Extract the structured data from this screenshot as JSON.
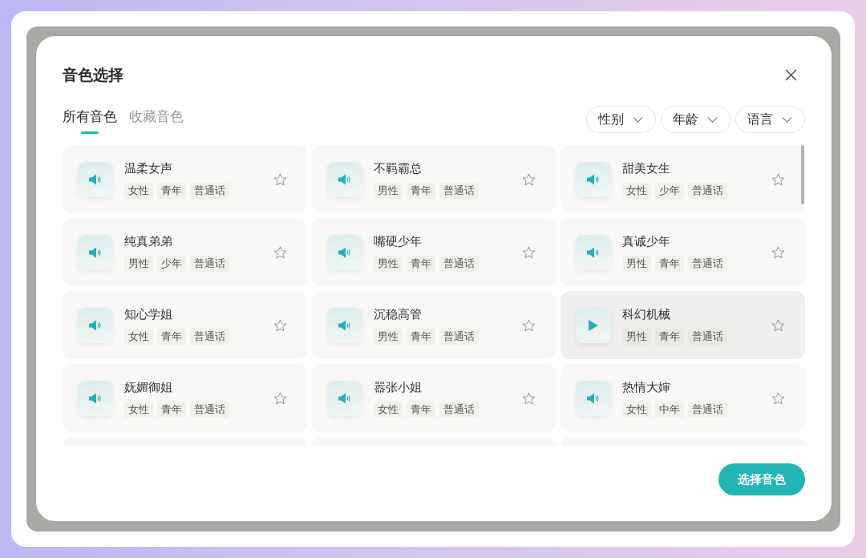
{
  "dialog": {
    "title": "音色选择"
  },
  "tabs": [
    {
      "label": "所有音色",
      "selected": true
    },
    {
      "label": "收藏音色",
      "selected": false
    }
  ],
  "filters": [
    {
      "label": "性别"
    },
    {
      "label": "年龄"
    },
    {
      "label": "语言"
    }
  ],
  "voices": [
    {
      "name": "温柔女声",
      "tags": [
        "女性",
        "青年",
        "普通话"
      ],
      "favorite": false,
      "hovered": false
    },
    {
      "name": "不羁霸总",
      "tags": [
        "男性",
        "青年",
        "普通话"
      ],
      "favorite": false,
      "hovered": false
    },
    {
      "name": "甜美女生",
      "tags": [
        "女性",
        "少年",
        "普通话"
      ],
      "favorite": false,
      "hovered": false
    },
    {
      "name": "纯真弟弟",
      "tags": [
        "男性",
        "少年",
        "普通话"
      ],
      "favorite": false,
      "hovered": false
    },
    {
      "name": "嘴硬少年",
      "tags": [
        "男性",
        "青年",
        "普通话"
      ],
      "favorite": false,
      "hovered": false
    },
    {
      "name": "真诚少年",
      "tags": [
        "男性",
        "青年",
        "普通话"
      ],
      "favorite": false,
      "hovered": false
    },
    {
      "name": "知心学姐",
      "tags": [
        "女性",
        "青年",
        "普通话"
      ],
      "favorite": false,
      "hovered": false
    },
    {
      "name": "沉稳高管",
      "tags": [
        "男性",
        "青年",
        "普通话"
      ],
      "favorite": false,
      "hovered": false
    },
    {
      "name": "科幻机械",
      "tags": [
        "男性",
        "青年",
        "普通话"
      ],
      "favorite": false,
      "hovered": true
    },
    {
      "name": "妩媚御姐",
      "tags": [
        "女性",
        "青年",
        "普通话"
      ],
      "favorite": false,
      "hovered": false
    },
    {
      "name": "嚣张小姐",
      "tags": [
        "女性",
        "青年",
        "普通话"
      ],
      "favorite": false,
      "hovered": false
    },
    {
      "name": "热情大婶",
      "tags": [
        "女性",
        "中年",
        "普通话"
      ],
      "favorite": false,
      "hovered": false
    }
  ],
  "confirm_button": "选择音色"
}
